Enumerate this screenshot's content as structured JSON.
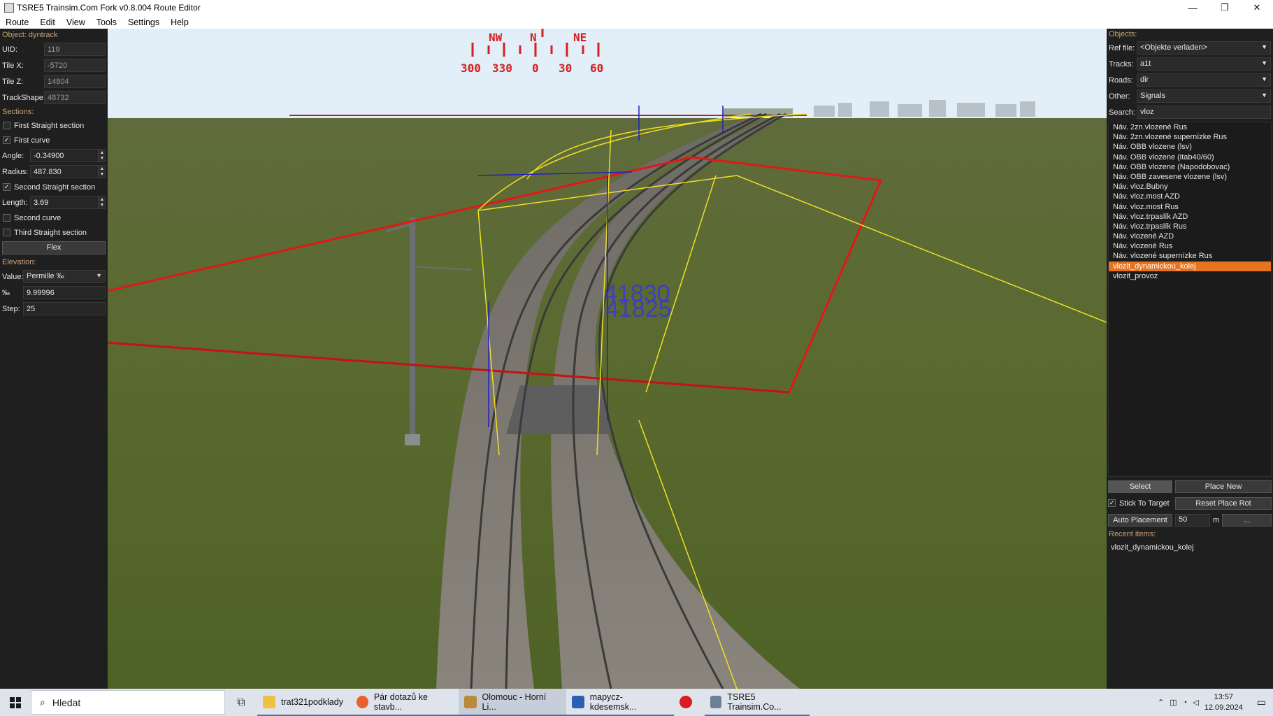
{
  "window": {
    "title": "TSRE5 Trainsim.Com Fork v0.8.004 Route Editor",
    "controls": [
      "—",
      "❐",
      "✕"
    ]
  },
  "menu": [
    "Route",
    "Edit",
    "View",
    "Tools",
    "Settings",
    "Help"
  ],
  "left_panel": {
    "object_label": "Object: dyntrack",
    "uid_label": "UID:",
    "uid_value": "119",
    "tilex_label": "Tile X:",
    "tilex_value": "-5720",
    "tilez_label": "Tile Z:",
    "tilez_value": "14804",
    "trackshape_label": "TrackShape:",
    "trackshape_value": "48732",
    "sections_label": "Sections:",
    "first_straight": {
      "label": "First Straight section",
      "checked": false
    },
    "first_curve": {
      "label": "First curve",
      "checked": true
    },
    "angle_label": "Angle:",
    "angle_value": "-0.34900",
    "radius_label": "Radius:",
    "radius_value": "487.830",
    "second_straight": {
      "label": "Second Straight section",
      "checked": true
    },
    "length_label": "Length:",
    "length_value": "3.69",
    "second_curve": {
      "label": "Second curve",
      "checked": false
    },
    "third_straight": {
      "label": "Third Straight section",
      "checked": false
    },
    "flex_label": "Flex",
    "elevation_label": "Elevation:",
    "value_label": "Value:",
    "value_select": "Permille ‰",
    "permille_label": "‰",
    "permille_value": "9.99996",
    "step_label": "Step:",
    "step_value": "25"
  },
  "viewport": {
    "compass": {
      "dirs": [
        "NW",
        "N",
        "NE"
      ],
      "degrees": [
        "300",
        "330",
        "0",
        "30",
        "60"
      ]
    },
    "track_ids": [
      "41830",
      "41825"
    ]
  },
  "right_panel": {
    "objects_label": "Objects:",
    "ref_label": "Ref file:",
    "ref_value": "<Objekte verladen>",
    "tracks_label": "Tracks:",
    "tracks_value": "a1t",
    "roads_label": "Roads:",
    "roads_value": "dir",
    "other_label": "Other:",
    "other_value": "Signals",
    "search_label": "Search:",
    "search_value": "vloz",
    "items": [
      "Náv. 2zn.vlozené Rus",
      "Náv. 2zn.vlozené supernízke Rus",
      "Náv. OBB vlozene (lsv)",
      "Náv. OBB vlozene (itab40/60)",
      "Náv. OBB vlozene (Napodobovac)",
      "Náv. OBB zavesene vlozene (lsv)",
      "Náv. vloz.Bubny",
      "Náv. vloz.most AZD",
      "Náv. vloz.most Rus",
      "Náv. vloz.trpaslík AZD",
      "Náv. vloz.trpaslík Rus",
      "Náv. vlozené AZD",
      "Náv. vlozené Rus",
      "Náv. vlozené supernízke Rus",
      "vlozit_dynamickou_kolej",
      "vlozit_provoz"
    ],
    "selected_index": 14,
    "select_label": "Select",
    "place_new_label": "Place New",
    "stick_label": "Stick To Target",
    "reset_rot_label": "Reset Place Rot",
    "auto_place_label": "Auto Placement",
    "auto_value": "50",
    "unit_m": "m",
    "dots": "...",
    "recent_label": "Recent items:",
    "recent_item": "vlozit_dynamickou_kolej"
  },
  "taskbar": {
    "search_placeholder": "Hledat",
    "apps": [
      {
        "label": "trat321podklady",
        "color": "#f0c040"
      },
      {
        "label": "Pár dotazů ke stavb...",
        "color": "#e8602c"
      },
      {
        "label": "Olomouc - Horní Li...",
        "color": "#b88a3a"
      },
      {
        "label": "mapycz-kdesemsk...",
        "color": "#2b5fb4"
      },
      {
        "label": "",
        "color": "#d91c1c"
      },
      {
        "label": "TSRE5 Trainsim.Co...",
        "color": "#6c7f95"
      }
    ],
    "time": "13:57",
    "date": "12.09.2024"
  },
  "colors": {
    "accent": "#e8731e",
    "label_orange": "#c8a27a",
    "panel_bg": "#1f1f1f",
    "compass_red": "#d42020"
  }
}
